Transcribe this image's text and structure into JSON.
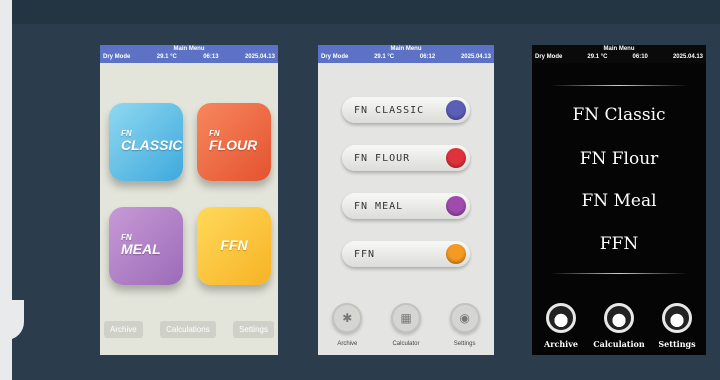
{
  "status": {
    "title": "Main Menu",
    "mode": "Dry Mode",
    "temp": "29.1 °C",
    "date": "2025.04.13"
  },
  "screen1": {
    "time": "06:13",
    "tiles": [
      {
        "small": "FN",
        "big": "CLASSIC",
        "color": "#3fa9dd"
      },
      {
        "small": "FN",
        "big": "FLOUR",
        "color": "#e3532f"
      },
      {
        "small": "FN",
        "big": "MEAL",
        "color": "#9c6bb8"
      },
      {
        "big": "FFN",
        "color": "#f7b325"
      }
    ],
    "bottom": [
      "Archive",
      "Calculations",
      "Settings"
    ]
  },
  "screen2": {
    "time": "06:12",
    "items": [
      {
        "label": "FN CLASSIC",
        "color": "#5b5fb8"
      },
      {
        "label": "FN FLOUR",
        "color": "#e0323b"
      },
      {
        "label": "FN MEAL",
        "color": "#a04ab0"
      },
      {
        "label": "FFN",
        "color": "#f49a22"
      }
    ],
    "bottom": [
      "Archive",
      "Calculator",
      "Settings"
    ],
    "icons": [
      "archive-icon",
      "calculator-icon",
      "settings-icon"
    ]
  },
  "screen3": {
    "time": "06:10",
    "items": [
      "FN Classic",
      "FN Flour",
      "FN Meal",
      "FFN"
    ],
    "bottom": [
      "Archive",
      "Calculation",
      "Settings"
    ]
  }
}
